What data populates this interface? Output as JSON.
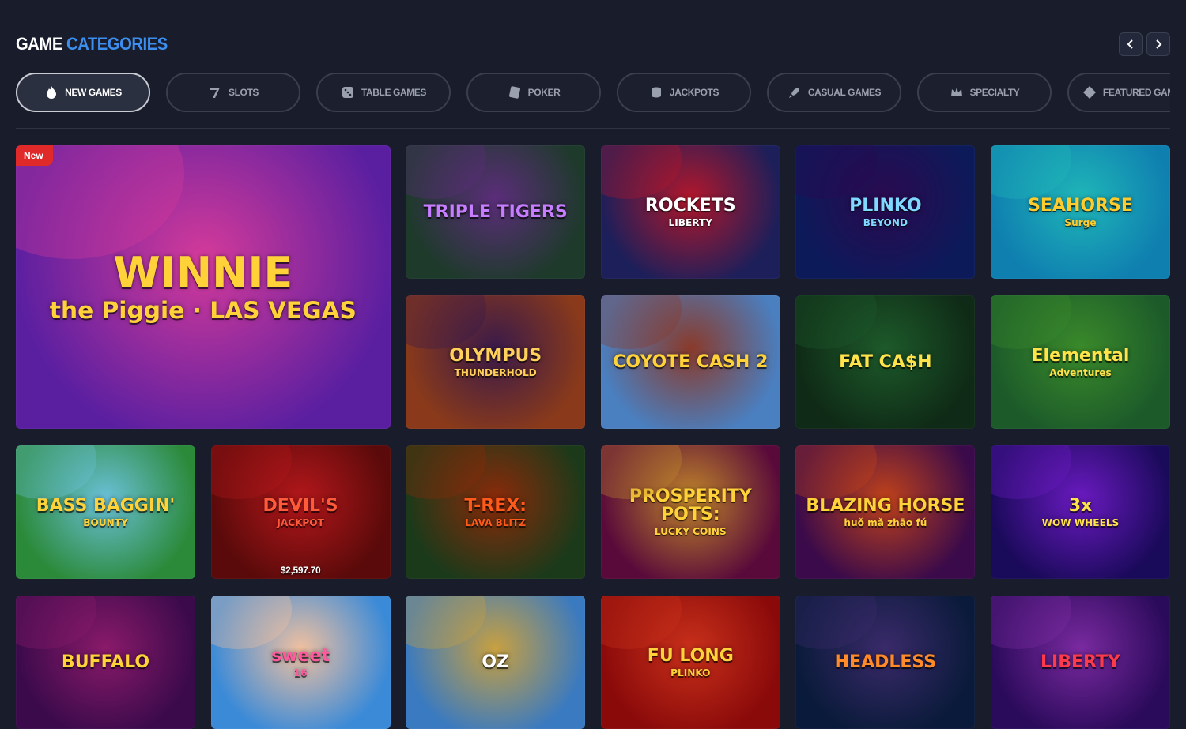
{
  "header": {
    "title_part1": "GAME",
    "title_part2": "CATEGORIES"
  },
  "tabs": [
    {
      "label": "NEW GAMES",
      "icon": "flame-icon",
      "active": true
    },
    {
      "label": "SLOTS",
      "icon": "seven-icon"
    },
    {
      "label": "TABLE GAMES",
      "icon": "dice-icon"
    },
    {
      "label": "POKER",
      "icon": "card-icon"
    },
    {
      "label": "JACKPOTS",
      "icon": "coins-icon"
    },
    {
      "label": "CASUAL GAMES",
      "icon": "rocket-icon"
    },
    {
      "label": "SPECIALTY",
      "icon": "crown-icon"
    },
    {
      "label": "FEATURED GAMES",
      "icon": "diamond-icon"
    }
  ],
  "games": [
    {
      "name": "WINNIE",
      "sub": "the Piggie · LAS VEGAS",
      "badge": "New",
      "colors": [
        "#5a1fa0",
        "#d43a9a"
      ],
      "text_color": "#ffd23a"
    },
    {
      "name": "TRIPLE TIGERS",
      "colors": [
        "#1d3a2a",
        "#5b2d7a"
      ],
      "text_color": "#c77dff"
    },
    {
      "name": "ROCKETS",
      "sub": "LIBERTY",
      "colors": [
        "#1c1f5a",
        "#b3172b"
      ],
      "text_color": "#ffffff"
    },
    {
      "name": "PLINKO",
      "sub": "BEYOND",
      "colors": [
        "#0c1a5a",
        "#2a0a4f"
      ],
      "text_color": "#7fd8ff"
    },
    {
      "name": "SEAHORSE",
      "sub": "Surge",
      "colors": [
        "#0f7fb0",
        "#1fb6b8"
      ],
      "text_color": "#ffcc2e"
    },
    {
      "name": "OLYMPUS",
      "sub": "THUNDERHOLD",
      "colors": [
        "#8a3a1a",
        "#3a1a4a"
      ],
      "text_color": "#ffd15a"
    },
    {
      "name": "COYOTE CASH 2",
      "colors": [
        "#4a7fc0",
        "#8a3a2a"
      ],
      "text_color": "#ffd23a"
    },
    {
      "name": "FAT CA$H",
      "colors": [
        "#0f2a16",
        "#1d5a2a"
      ],
      "text_color": "#ffe34a"
    },
    {
      "name": "Elemental",
      "sub": "Adventures",
      "colors": [
        "#1c5a2a",
        "#3a8a2a"
      ],
      "text_color": "#ffe34a"
    },
    {
      "name": "BASS BAGGIN'",
      "sub": "BOUNTY",
      "colors": [
        "#2b8a3a",
        "#6ac0d8"
      ],
      "text_color": "#ffd23a"
    },
    {
      "name": "DEVIL'S",
      "sub": "JACKPOT",
      "jackpot": "$2,597.70",
      "colors": [
        "#5a0a0a",
        "#b3171b"
      ],
      "text_color": "#ff5a3a"
    },
    {
      "name": "T-REX:",
      "sub": "LAVA BLITZ",
      "colors": [
        "#1a3a1a",
        "#8a2a0a"
      ],
      "text_color": "#ff5a1a"
    },
    {
      "name": "PROSPERITY POTS:",
      "sub": "LUCKY COINS",
      "colors": [
        "#5a0a3a",
        "#c0862a"
      ],
      "text_color": "#ffd23a"
    },
    {
      "name": "BLAZING HORSE",
      "sub": "huǒ mǎ zhāo fú",
      "colors": [
        "#3a0a4a",
        "#c0421a"
      ],
      "text_color": "#ffd23a"
    },
    {
      "name": "3x",
      "sub": "WOW WHEELS",
      "colors": [
        "#1a0a5a",
        "#6a1ac0"
      ],
      "text_color": "#ffe34a"
    },
    {
      "name": "BUFFALO",
      "colors": [
        "#3a0a4a",
        "#8a1a6a"
      ],
      "text_color": "#ffd23a"
    },
    {
      "name": "sweet",
      "sub": "16",
      "colors": [
        "#3a8ad8",
        "#f0c0a0"
      ],
      "text_color": "#ff5aa0"
    },
    {
      "name": "OZ",
      "colors": [
        "#3a7ac0",
        "#c8a040"
      ],
      "text_color": "#ffffff"
    },
    {
      "name": "FU LONG",
      "sub": "PLINKO",
      "colors": [
        "#8a0a0a",
        "#c8301a"
      ],
      "text_color": "#ffd23a"
    },
    {
      "name": "HEADLESS",
      "colors": [
        "#0a1a3a",
        "#3a2a6a"
      ],
      "text_color": "#ff8a2a"
    },
    {
      "name": "LIBERTY",
      "colors": [
        "#2a0a5a",
        "#7a2aa0"
      ],
      "text_color": "#ff3a4a"
    }
  ]
}
